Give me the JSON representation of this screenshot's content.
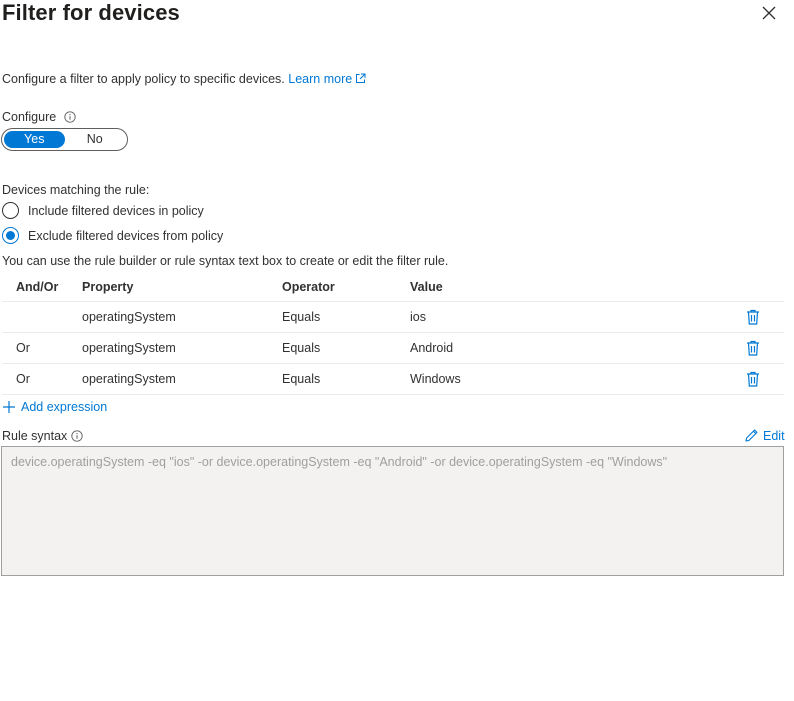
{
  "panel": {
    "title": "Filter for devices",
    "description": "Configure a filter to apply policy to specific devices.",
    "learn_more": "Learn more"
  },
  "configure": {
    "label": "Configure",
    "options": [
      "Yes",
      "No"
    ],
    "selected": "Yes"
  },
  "devices_matching": {
    "label": "Devices matching the rule:",
    "options": [
      {
        "label": "Include filtered devices in policy",
        "checked": false
      },
      {
        "label": "Exclude filtered devices from policy",
        "checked": true
      }
    ]
  },
  "rule_builder": {
    "hint": "You can use the rule builder or rule syntax text box to create or edit the filter rule.",
    "columns": {
      "andor": "And/Or",
      "property": "Property",
      "operator": "Operator",
      "value": "Value"
    },
    "rows": [
      {
        "andor": "",
        "property": "operatingSystem",
        "operator": "Equals",
        "value": "ios"
      },
      {
        "andor": "Or",
        "property": "operatingSystem",
        "operator": "Equals",
        "value": "Android"
      },
      {
        "andor": "Or",
        "property": "operatingSystem",
        "operator": "Equals",
        "value": "Windows"
      }
    ],
    "add_expression": "Add expression"
  },
  "rule_syntax": {
    "label": "Rule syntax",
    "edit_label": "Edit",
    "value": "device.operatingSystem -eq \"ios\" -or device.operatingSystem -eq \"Android\" -or device.operatingSystem -eq \"Windows\""
  },
  "colors": {
    "accent": "#0078d4",
    "text": "#323130",
    "disabled_text": "#a19f9d",
    "disabled_bg": "#f3f2f1"
  },
  "icons": {
    "close": "close-icon",
    "external_link": "external-link-icon",
    "info": "info-icon",
    "delete": "trash-icon",
    "add": "plus-icon",
    "edit": "pencil-icon"
  }
}
